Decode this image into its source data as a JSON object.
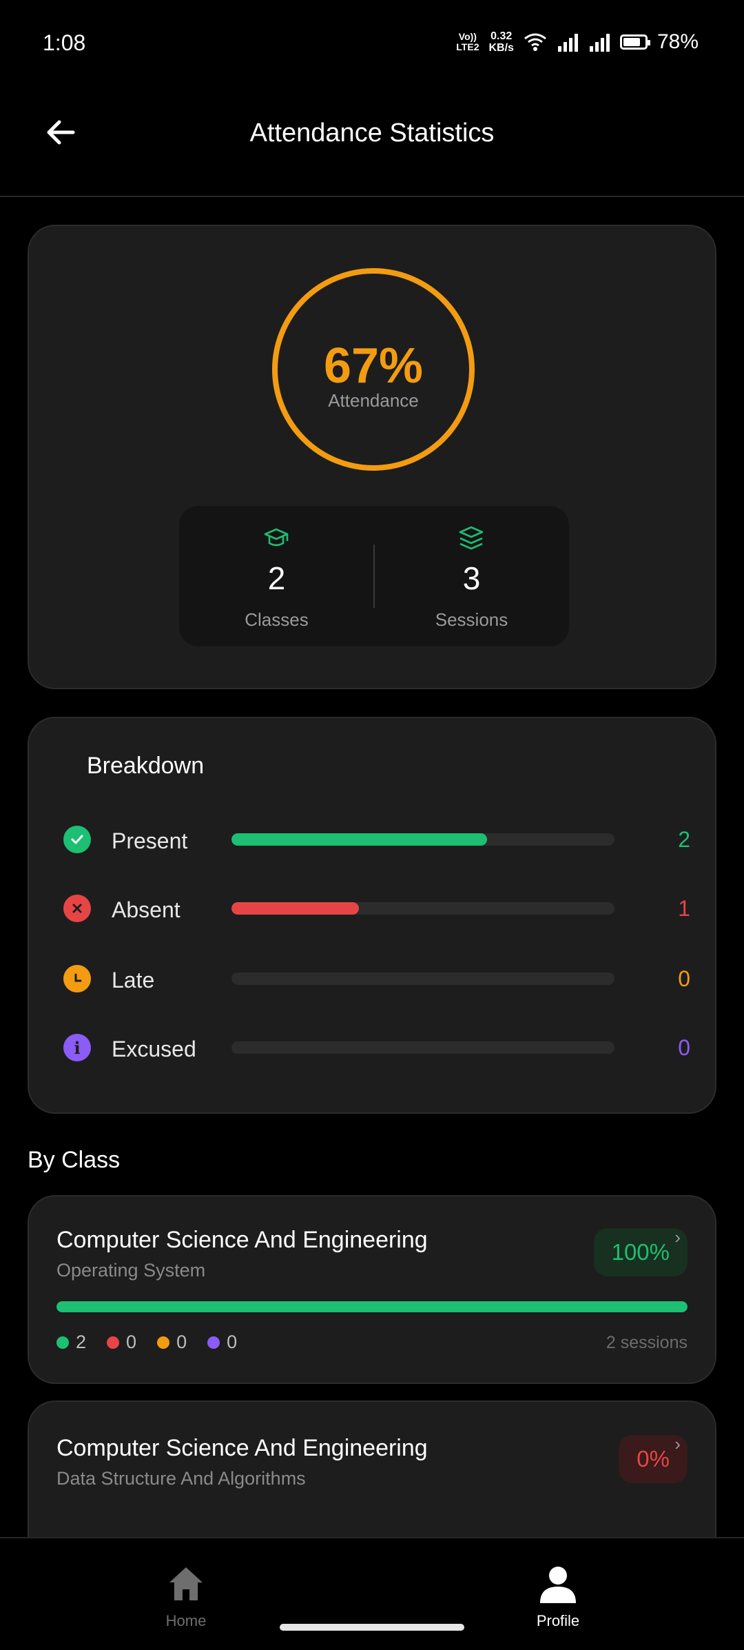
{
  "status_bar": {
    "time": "1:08",
    "network_top": "Vo))",
    "network_bottom": "LTE2",
    "speed_value": "0.32",
    "speed_unit": "KB/s",
    "battery": "78%"
  },
  "header": {
    "title": "Attendance Statistics"
  },
  "overview": {
    "percent": "67%",
    "percent_value": 0.67,
    "label": "Attendance",
    "ring_color": "#f39c12",
    "classes_value": "2",
    "classes_label": "Classes",
    "sessions_value": "3",
    "sessions_label": "Sessions"
  },
  "breakdown": {
    "title": "Breakdown",
    "rows": [
      {
        "label": "Present",
        "count": "2",
        "fraction": 0.667,
        "color": "#1dbf73",
        "icon": "check-icon"
      },
      {
        "label": "Absent",
        "count": "1",
        "fraction": 0.333,
        "color": "#e74545",
        "icon": "x-icon"
      },
      {
        "label": "Late",
        "count": "0",
        "fraction": 0,
        "color": "#f39c12",
        "icon": "clock-icon"
      },
      {
        "label": "Excused",
        "count": "0",
        "fraction": 0,
        "color": "#8b5cf6",
        "icon": "info-icon"
      }
    ]
  },
  "by_class": {
    "title": "By Class",
    "classes": [
      {
        "title": "Computer Science And Engineering",
        "subject": "Operating System",
        "percent": "100%",
        "fraction": 1.0,
        "present": "2",
        "absent": "0",
        "late": "0",
        "excused": "0",
        "sessions": "2 sessions"
      },
      {
        "title": "Computer Science And Engineering",
        "subject": "Data Structure And Algorithms",
        "percent": "0%",
        "fraction": 0
      }
    ]
  },
  "nav": {
    "home": "Home",
    "profile": "Profile"
  },
  "colors": {
    "present": "#1dbf73",
    "absent": "#e74545",
    "late": "#f39c12",
    "excused": "#8b5cf6"
  }
}
